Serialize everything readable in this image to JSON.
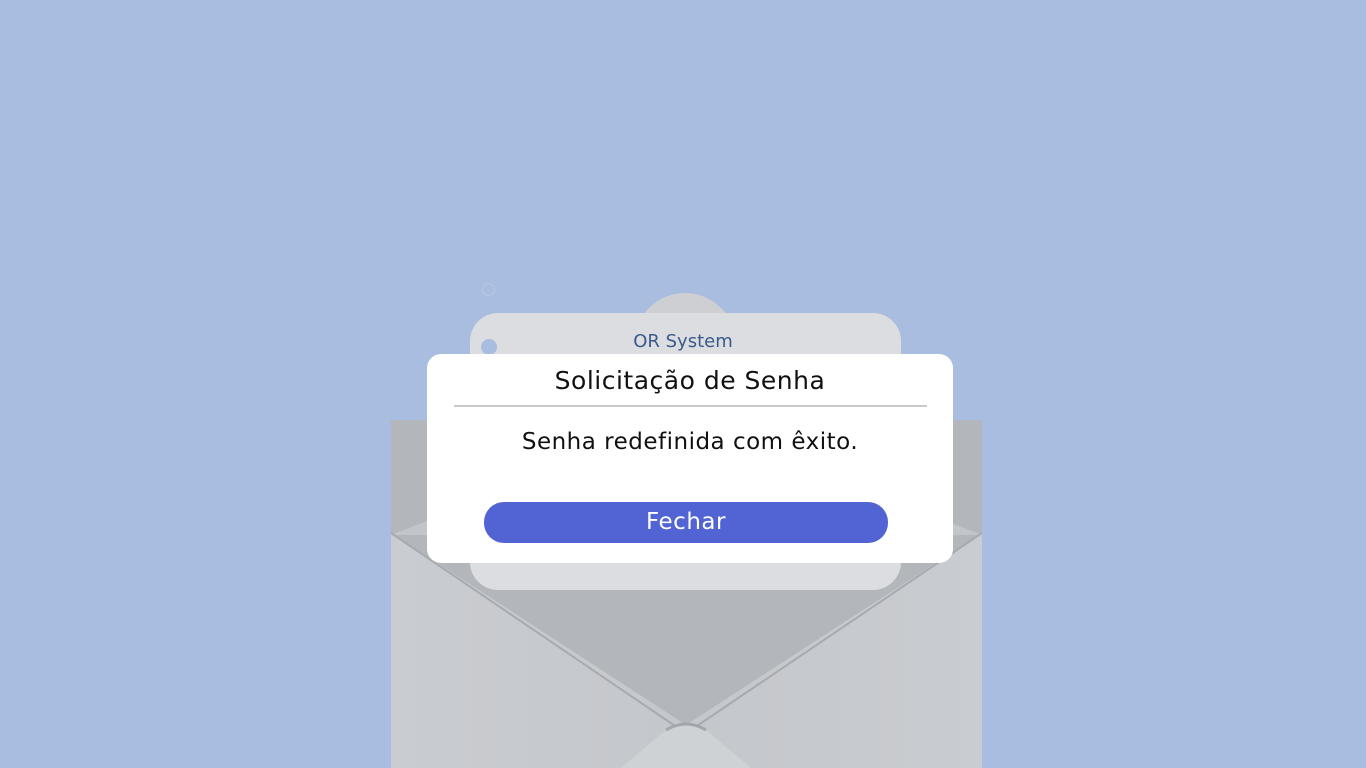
{
  "background": {
    "color": "#a9bde0"
  },
  "envelope": {
    "letter": {
      "brand": "OR System"
    }
  },
  "dialog": {
    "title": "Solicitação de Senha",
    "message": "Senha redefinida com êxito.",
    "close_button_label": "Fechar",
    "accent_color": "#5264d4"
  }
}
